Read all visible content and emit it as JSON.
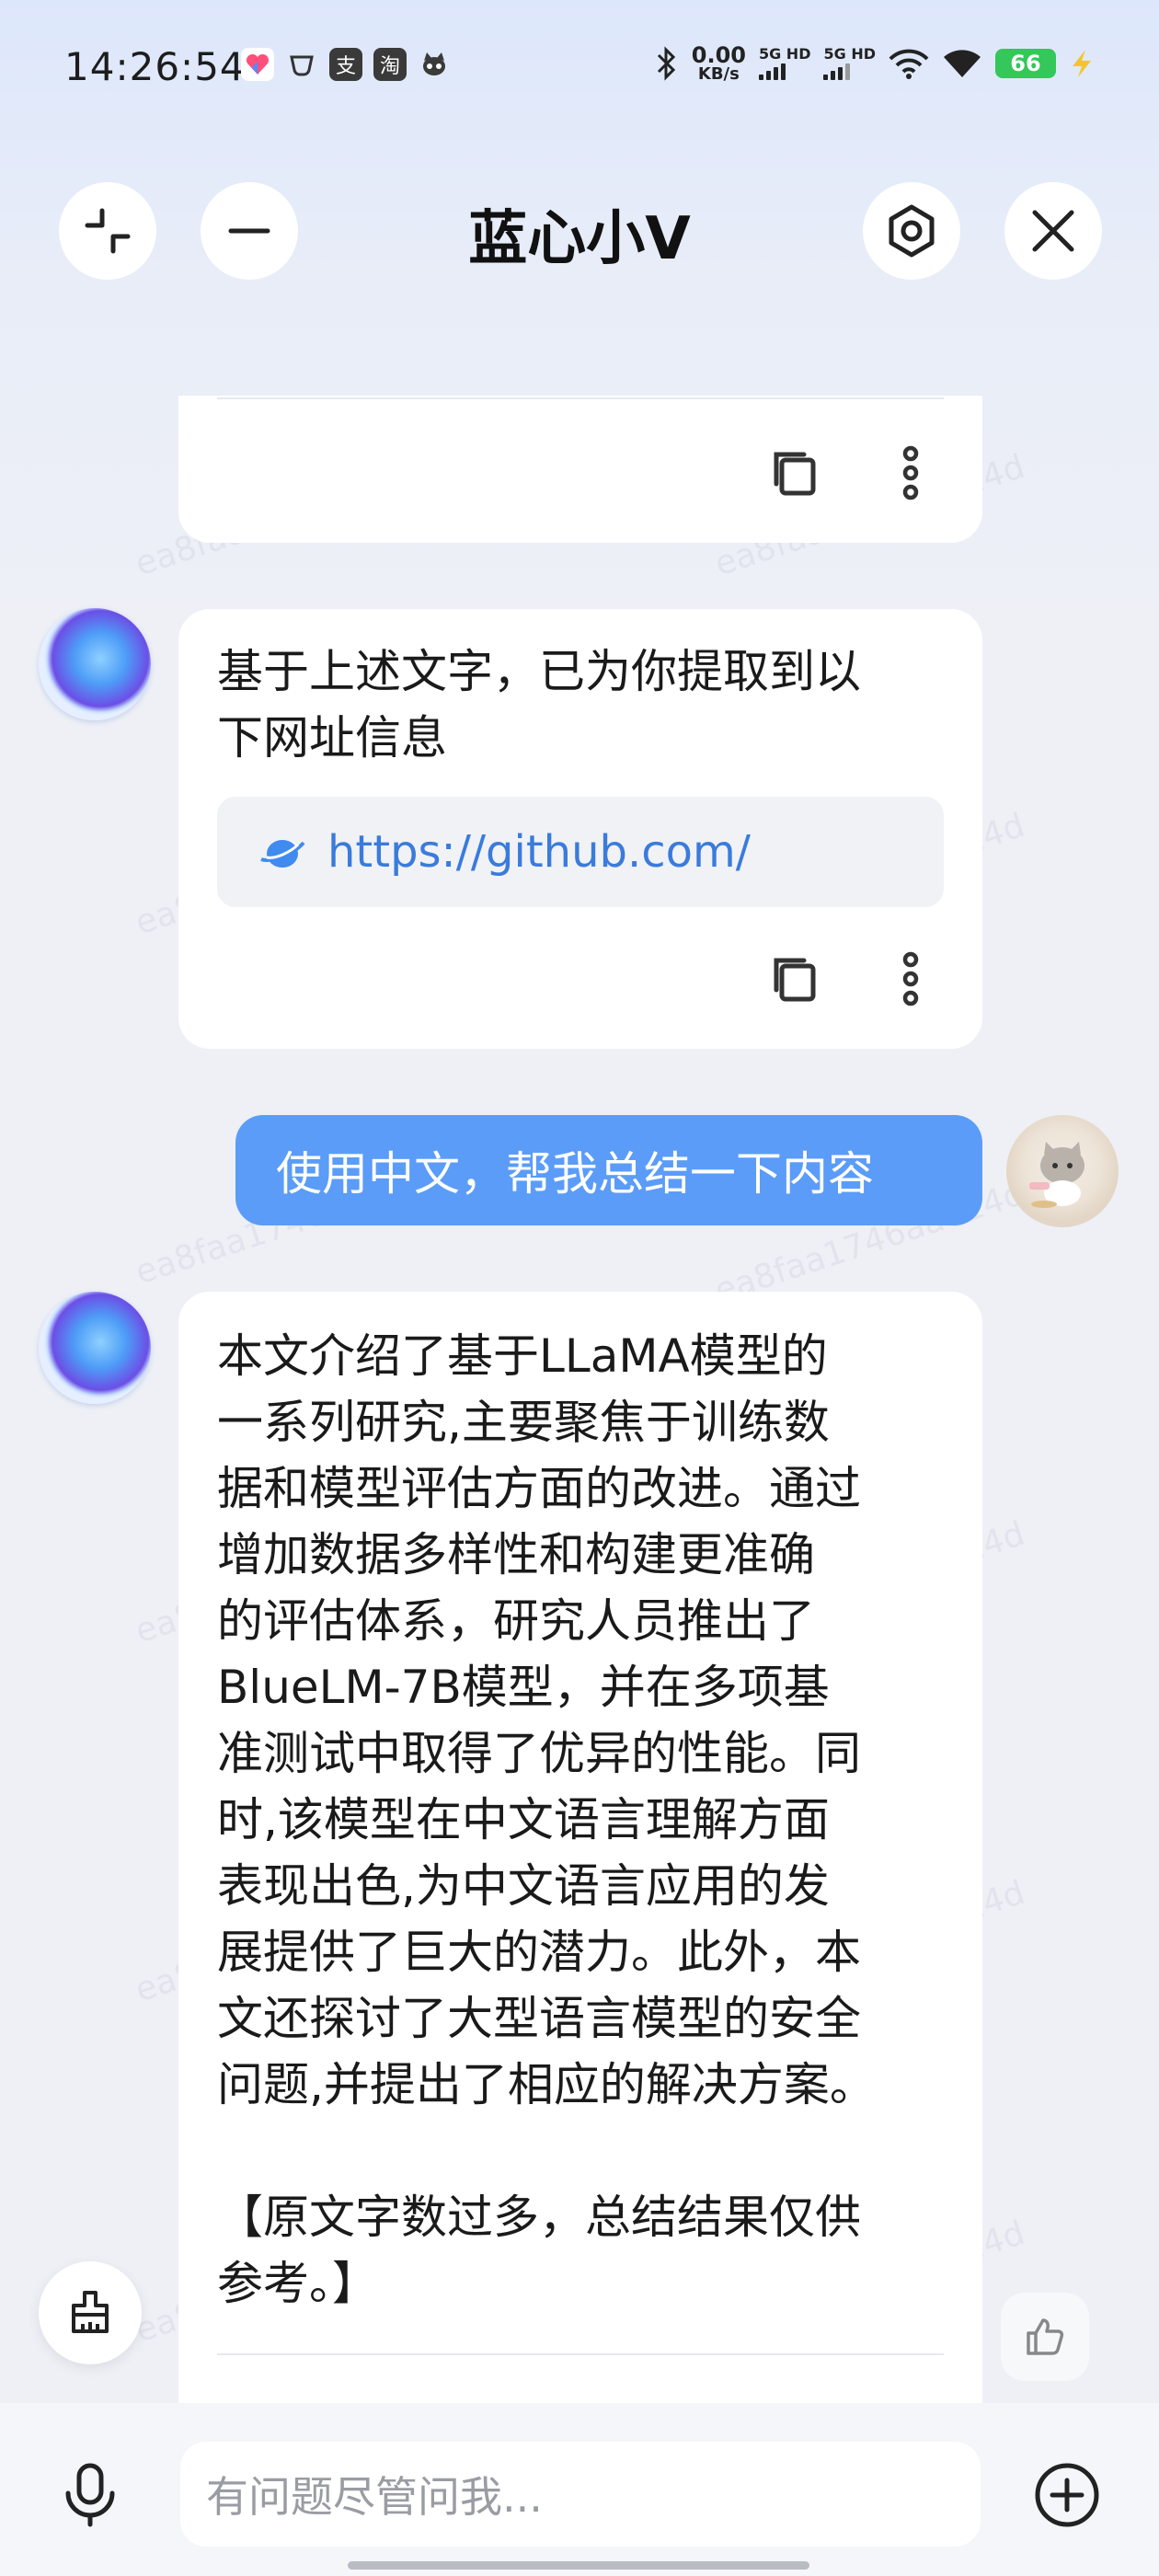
{
  "status_bar": {
    "time": "14:26:54",
    "net_speed_value": "0.00",
    "net_speed_unit": "KB/s",
    "sim1_label": "5G HD",
    "sim2_label": "5G HD",
    "battery": "66",
    "app_icons": [
      "health-app-icon",
      "cup-app-icon",
      "alipay-app-icon",
      "taobao-app-icon",
      "cat-app-icon"
    ]
  },
  "header": {
    "title": "蓝心小V"
  },
  "messages": {
    "prev_card": {},
    "link_card": {
      "text_line1": "基于上述文字，已为你提取到以",
      "text_line2": "下网址信息",
      "link": "https://github.com/"
    },
    "user_message": {
      "text": "使用中文，帮我总结一下内容"
    },
    "summary_card": {
      "lines": [
        "本文介绍了基于LLaMA模型的",
        "一系列研究,主要聚焦于训练数",
        "据和模型评估方面的改进。通过",
        "增加数据多样性和构建更准确",
        "的评估体系，研究人员推出了",
        "BlueLM-7B模型，并在多项基",
        "准测试中取得了优异的性能。同",
        "时,该模型在中文语言理解方面",
        "表现出色,为中文语言应用的发",
        "展提供了巨大的潜力。此外，本",
        "文还探讨了大型语言模型的安全",
        "问题,并提出了相应的解决方案。",
        "",
        "【原文字数过多，总结结果仅供",
        "参考。】"
      ]
    }
  },
  "watermark": {
    "text": "ea8faa1746aa014d"
  },
  "input": {
    "placeholder": "有问题尽管问我..."
  }
}
